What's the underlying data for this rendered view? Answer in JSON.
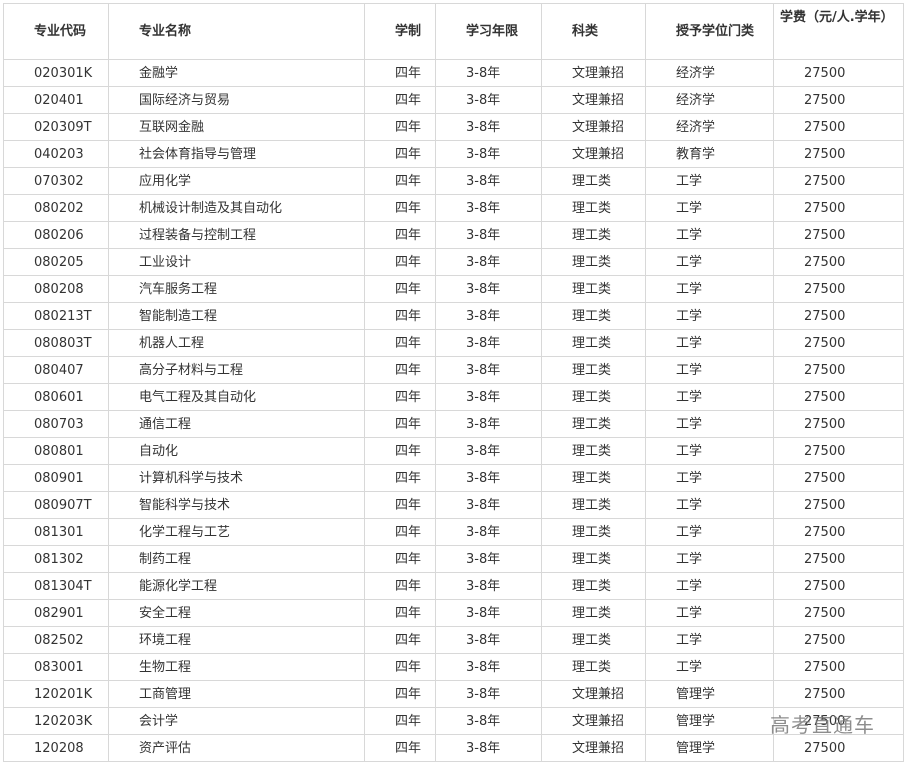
{
  "table": {
    "headers": [
      "专业代码",
      "专业名称",
      "学制",
      "学习年限",
      "科类",
      "授予学位门类",
      "学费（元/人.学年）"
    ],
    "rows": [
      [
        "020301K",
        "金融学",
        "四年",
        "3-8年",
        "文理兼招",
        "经济学",
        "27500"
      ],
      [
        "020401",
        "国际经济与贸易",
        "四年",
        "3-8年",
        "文理兼招",
        "经济学",
        "27500"
      ],
      [
        "020309T",
        "互联网金融",
        "四年",
        "3-8年",
        "文理兼招",
        "经济学",
        "27500"
      ],
      [
        "040203",
        "社会体育指导与管理",
        "四年",
        "3-8年",
        "文理兼招",
        "教育学",
        "27500"
      ],
      [
        "070302",
        "应用化学",
        "四年",
        "3-8年",
        "理工类",
        "工学",
        "27500"
      ],
      [
        "080202",
        "机械设计制造及其自动化",
        "四年",
        "3-8年",
        "理工类",
        "工学",
        "27500"
      ],
      [
        "080206",
        "过程装备与控制工程",
        "四年",
        "3-8年",
        "理工类",
        "工学",
        "27500"
      ],
      [
        "080205",
        "工业设计",
        "四年",
        "3-8年",
        "理工类",
        "工学",
        "27500"
      ],
      [
        "080208",
        "汽车服务工程",
        "四年",
        "3-8年",
        "理工类",
        "工学",
        "27500"
      ],
      [
        "080213T",
        "智能制造工程",
        "四年",
        "3-8年",
        "理工类",
        "工学",
        "27500"
      ],
      [
        "080803T",
        "机器人工程",
        "四年",
        "3-8年",
        "理工类",
        "工学",
        "27500"
      ],
      [
        "080407",
        "高分子材料与工程",
        "四年",
        "3-8年",
        "理工类",
        "工学",
        "27500"
      ],
      [
        "080601",
        "电气工程及其自动化",
        "四年",
        "3-8年",
        "理工类",
        "工学",
        "27500"
      ],
      [
        "080703",
        "通信工程",
        "四年",
        "3-8年",
        "理工类",
        "工学",
        "27500"
      ],
      [
        "080801",
        "自动化",
        "四年",
        "3-8年",
        "理工类",
        "工学",
        "27500"
      ],
      [
        "080901",
        "计算机科学与技术",
        "四年",
        "3-8年",
        "理工类",
        "工学",
        "27500"
      ],
      [
        "080907T",
        "智能科学与技术",
        "四年",
        "3-8年",
        "理工类",
        "工学",
        "27500"
      ],
      [
        "081301",
        "化学工程与工艺",
        "四年",
        "3-8年",
        "理工类",
        "工学",
        "27500"
      ],
      [
        "081302",
        "制药工程",
        "四年",
        "3-8年",
        "理工类",
        "工学",
        "27500"
      ],
      [
        "081304T",
        "能源化学工程",
        "四年",
        "3-8年",
        "理工类",
        "工学",
        "27500"
      ],
      [
        "082901",
        "安全工程",
        "四年",
        "3-8年",
        "理工类",
        "工学",
        "27500"
      ],
      [
        "082502",
        "环境工程",
        "四年",
        "3-8年",
        "理工类",
        "工学",
        "27500"
      ],
      [
        "083001",
        "生物工程",
        "四年",
        "3-8年",
        "理工类",
        "工学",
        "27500"
      ],
      [
        "120201K",
        "工商管理",
        "四年",
        "3-8年",
        "文理兼招",
        "管理学",
        "27500"
      ],
      [
        "120203K",
        "会计学",
        "四年",
        "3-8年",
        "文理兼招",
        "管理学",
        "27500"
      ],
      [
        "120208",
        "资产评估",
        "四年",
        "3-8年",
        "文理兼招",
        "管理学",
        "27500"
      ]
    ]
  },
  "watermark": "高考直通车"
}
